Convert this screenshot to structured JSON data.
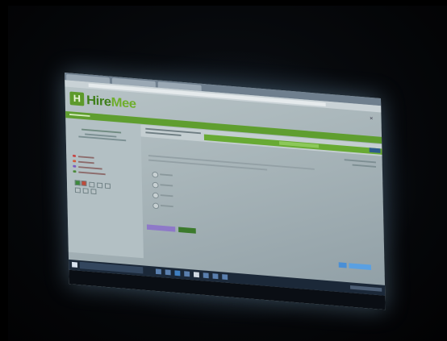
{
  "brand": {
    "logo_letter": "H",
    "name_part1": "Hire",
    "name_part2": "Mee"
  },
  "colors": {
    "brand_green": "#5f9e2f",
    "brand_light_green": "#6fae2c",
    "purple_button": "#8e79c8",
    "dark_green_button": "#3c7a2c",
    "blue_button": "#4a8fd6",
    "taskbar": "#1b2838"
  },
  "icons": {
    "close": "close-icon",
    "start": "windows-start-icon"
  }
}
